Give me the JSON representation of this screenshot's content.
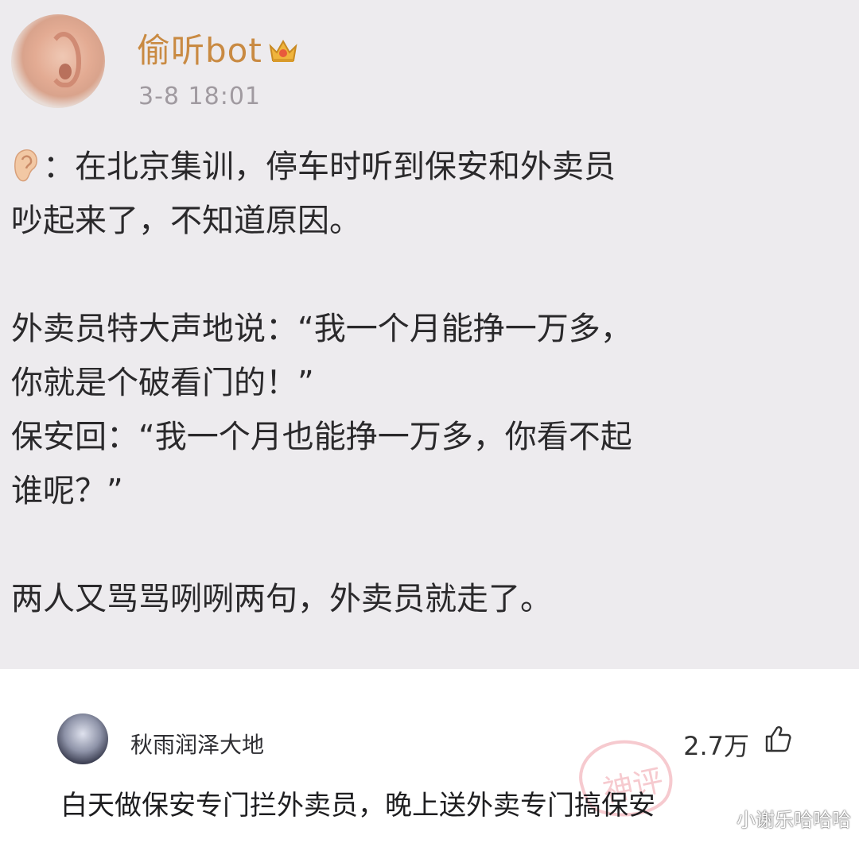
{
  "post": {
    "username": "偷听bot",
    "timestamp": "3-8 18:01",
    "badge_icon": "vip-crown-icon",
    "avatar_icon": "ear-avatar",
    "lines": [
      "：在北京集训，停车时听到保安和外卖员",
      "吵起来了，不知道原因。",
      "",
      "外卖员特大声地说：“我一个月能挣一万多，",
      "你就是个破看门的！”",
      "保安回：“我一个月也能挣一万多，你看不起",
      "谁呢？”",
      "",
      "两人又骂骂咧咧两句，外卖员就走了。"
    ]
  },
  "comment": {
    "name": "秋雨润泽大地",
    "likes": "2.7万",
    "text": "白天做保安专门拦外卖员，晚上送外卖专门搞保安",
    "stamp_label": "神评"
  },
  "watermark": "小谢乐哈哈哈",
  "colors": {
    "post_bg": "#edebee",
    "username": "#c98a42",
    "timestamp": "#a09aa0",
    "body_text": "#2a292b",
    "stamp": "#e86a78"
  }
}
